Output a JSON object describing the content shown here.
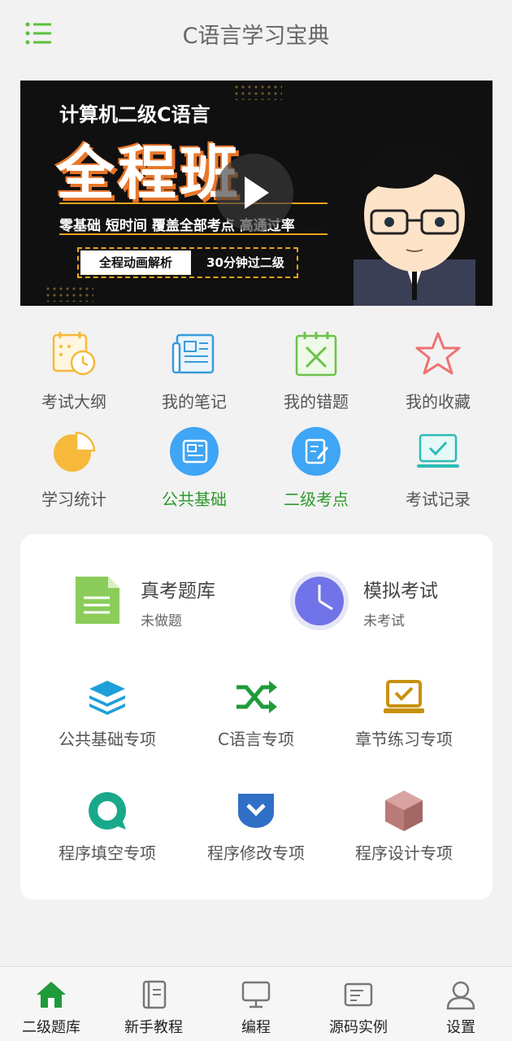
{
  "header": {
    "title": "C语言学习宝典",
    "menu_icon": "menu-list-icon"
  },
  "banner": {
    "line1": "计算机二级C语言",
    "headline": "全程班",
    "features": "零基础  短时间  覆盖全部考点  高通过率",
    "tag1": "全程动画解析",
    "tag2": "30分钟过二级",
    "play_icon": "play-icon"
  },
  "quick_grid": [
    {
      "label": "考试大纲",
      "icon": "calendar-clock-icon",
      "color": "#f6b93b"
    },
    {
      "label": "我的笔记",
      "icon": "newspaper-icon",
      "color": "#3a9ad9"
    },
    {
      "label": "我的错题",
      "icon": "wrong-x-icon",
      "color": "#6cc24a"
    },
    {
      "label": "我的收藏",
      "icon": "star-icon",
      "color": "#f07171"
    },
    {
      "label": "学习统计",
      "icon": "pie-chart-icon",
      "color": "#f6b93b"
    },
    {
      "label": "公共基础",
      "icon": "book-icon",
      "color": "#3fa5f5"
    },
    {
      "label": "二级考点",
      "icon": "edit-note-icon",
      "color": "#3fa5f5"
    },
    {
      "label": "考试记录",
      "icon": "monitor-check-icon",
      "color": "#2bbcb5"
    }
  ],
  "card": {
    "exam_bank": {
      "title": "真考题库",
      "subtitle": "未做题"
    },
    "mock_exam": {
      "title": "模拟考试",
      "subtitle": "未考试"
    },
    "topics": [
      {
        "label": "公共基础专项",
        "icon": "layers-icon"
      },
      {
        "label": "C语言专项",
        "icon": "shuffle-icon"
      },
      {
        "label": "章节练习专项",
        "icon": "laptop-check-icon"
      },
      {
        "label": "程序填空专项",
        "icon": "speech-bubble-icon"
      },
      {
        "label": "程序修改专项",
        "icon": "shield-chevron-icon"
      },
      {
        "label": "程序设计专项",
        "icon": "cube-icon"
      }
    ]
  },
  "tabbar": [
    {
      "label": "二级题库",
      "icon": "home-icon",
      "active": true
    },
    {
      "label": "新手教程",
      "icon": "book-icon"
    },
    {
      "label": "编程",
      "icon": "monitor-icon"
    },
    {
      "label": "源码实例",
      "icon": "document-icon"
    },
    {
      "label": "设置",
      "icon": "user-icon"
    }
  ],
  "colors": {
    "accent": "#2e9a2e",
    "background": "#f2f2f2",
    "card": "#ffffff"
  }
}
